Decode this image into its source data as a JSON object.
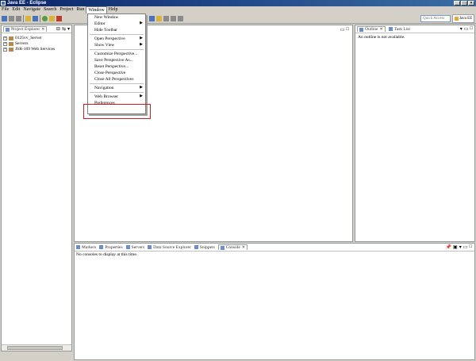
{
  "window": {
    "title": "Java EE - Eclipse"
  },
  "menubar": [
    "File",
    "Edit",
    "Navigate",
    "Search",
    "Project",
    "Run",
    "Window",
    "Help"
  ],
  "toolbar": {
    "quick_access_placeholder": "Quick Access",
    "perspective": "Java EE"
  },
  "window_menu": [
    {
      "label": "New Window"
    },
    {
      "label": "Editor",
      "submenu": true
    },
    {
      "label": "Hide Toolbar"
    },
    {
      "label": "Open Perspective",
      "submenu": true
    },
    {
      "label": "Show View",
      "submenu": true
    },
    {
      "label": "Customize Perspective..."
    },
    {
      "label": "Save Perspective As..."
    },
    {
      "label": "Reset Perspective..."
    },
    {
      "label": "Close Perspective"
    },
    {
      "label": "Close All Perspectives"
    },
    {
      "label": "Navigation",
      "submenu": true
    },
    {
      "label": "Web Browser",
      "submenu": true
    },
    {
      "label": "Preferences"
    }
  ],
  "explorer": {
    "tab": "Project Explorer",
    "items": [
      "0125vv_Server",
      "Servers",
      "JSR-109 Web Services"
    ]
  },
  "outline": {
    "tabs": [
      "Outline",
      "Task List"
    ],
    "message": "An outline is not available."
  },
  "console": {
    "tabs": [
      "Markers",
      "Properties",
      "Servers",
      "Data Source Explorer",
      "Snippets",
      "Console"
    ],
    "message": "No consoles to display at this time."
  }
}
